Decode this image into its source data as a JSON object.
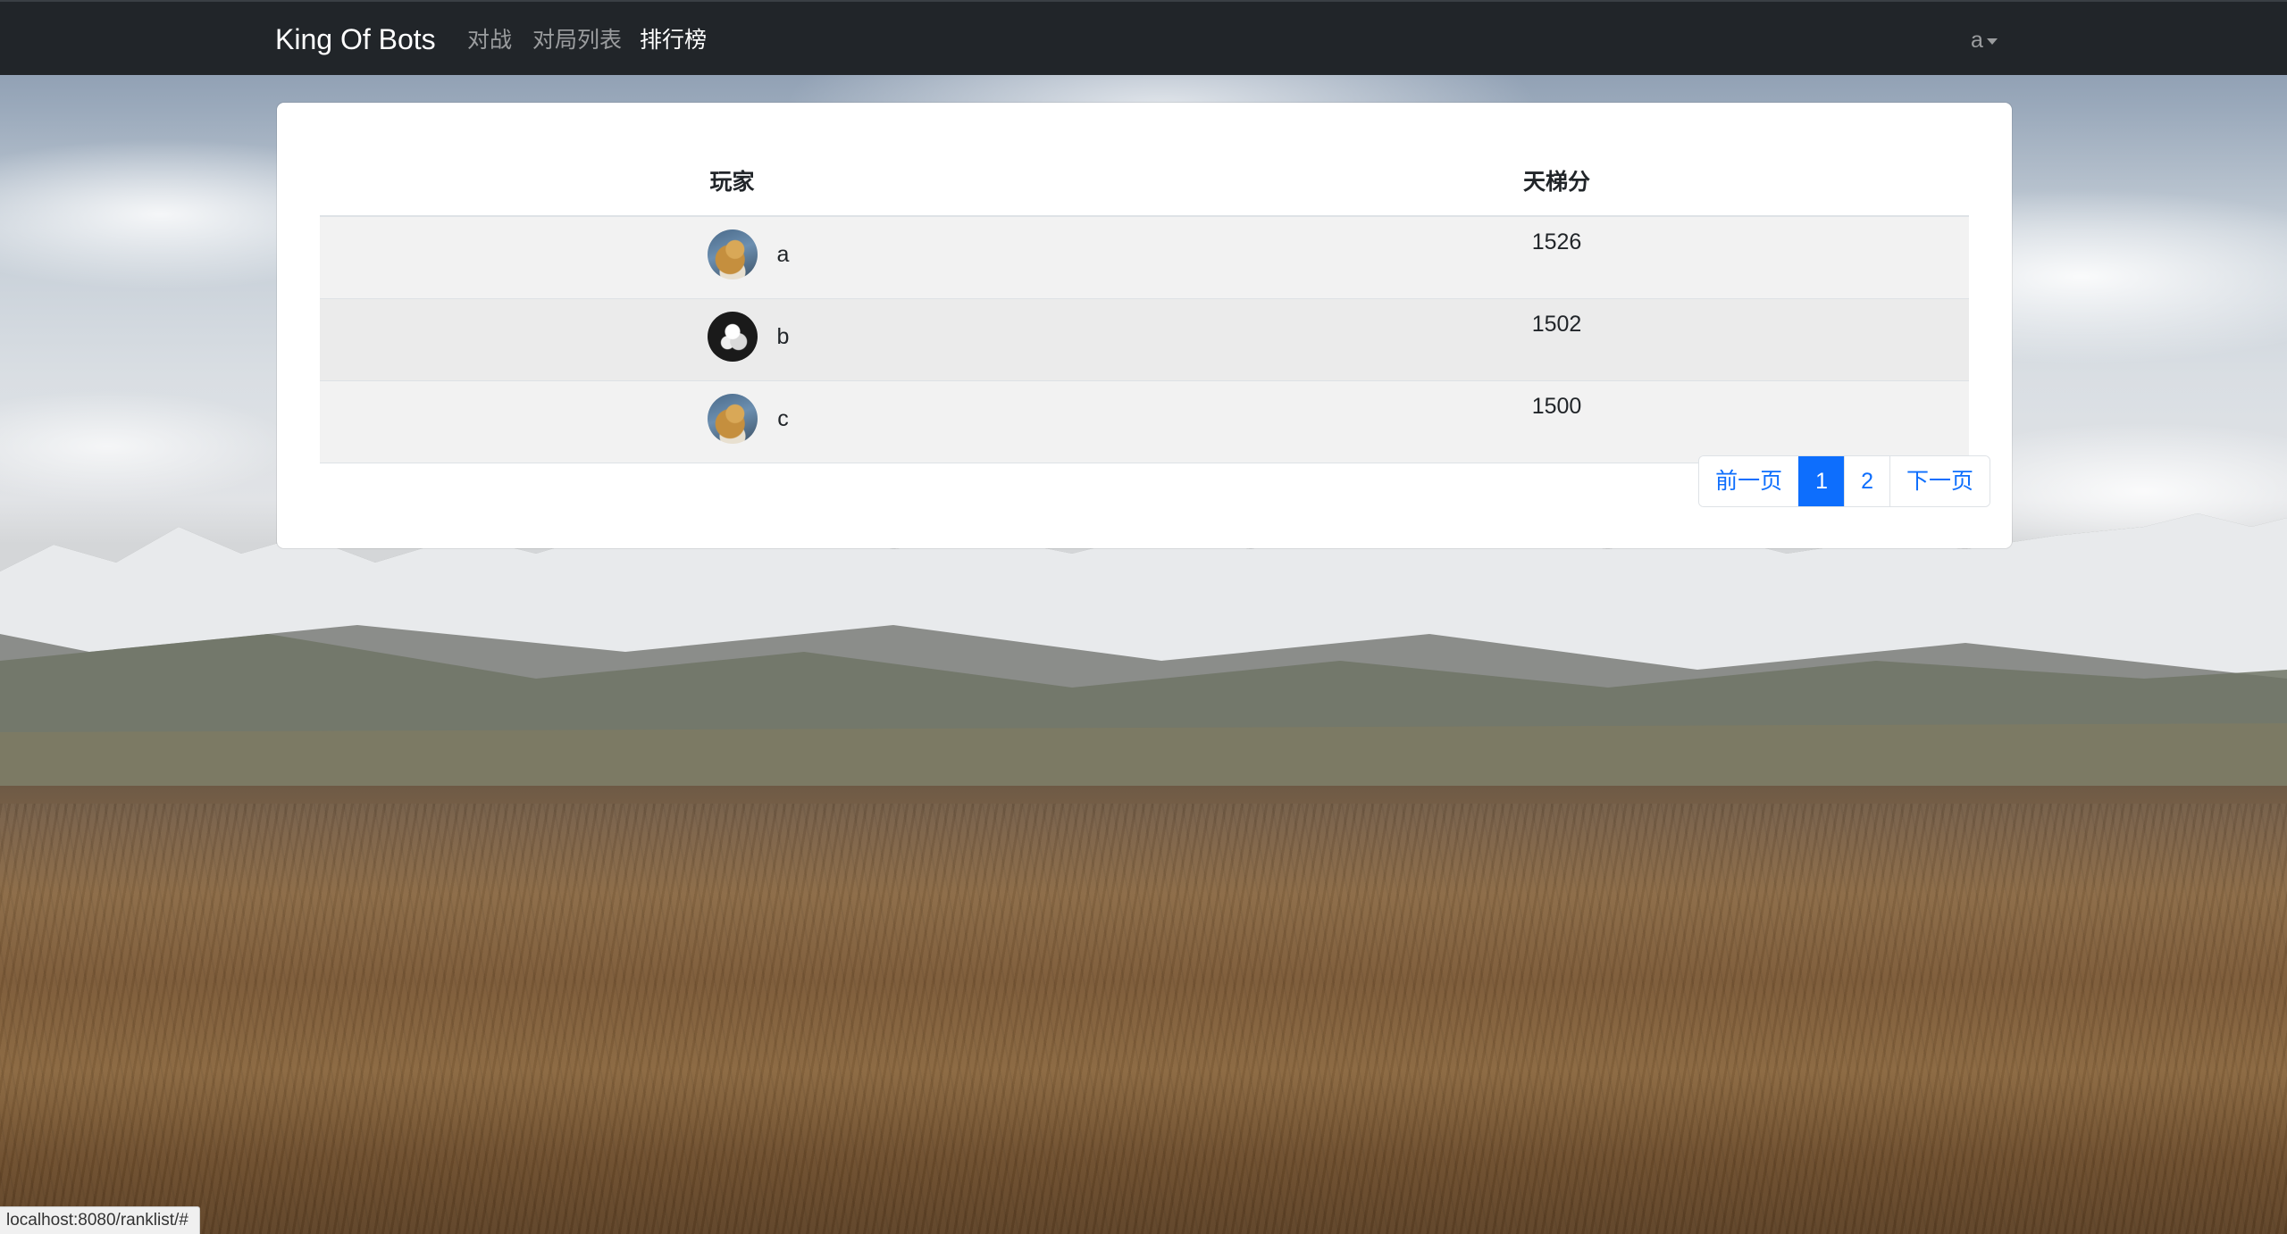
{
  "navbar": {
    "brand": "King Of Bots",
    "links": [
      {
        "label": "对战"
      },
      {
        "label": "对局列表"
      },
      {
        "label": "排行榜"
      }
    ],
    "user": "a"
  },
  "ranklist": {
    "headers": {
      "player": "玩家",
      "rating": "天梯分"
    },
    "rows": [
      {
        "name": "a",
        "rating": "1526",
        "avatar": "landscape-photo-avatar"
      },
      {
        "name": "b",
        "rating": "1502",
        "avatar": "dark-cartoon-avatar"
      },
      {
        "name": "c",
        "rating": "1500",
        "avatar": "landscape-photo-avatar"
      }
    ]
  },
  "pagination": {
    "prev": "前一页",
    "pages": [
      "1",
      "2"
    ],
    "active_page": "1",
    "next": "下一页"
  },
  "statusbar": {
    "url": "localhost:8080/ranklist/#"
  },
  "colors": {
    "navbar_bg": "#212529",
    "accent": "#0d6efd"
  }
}
